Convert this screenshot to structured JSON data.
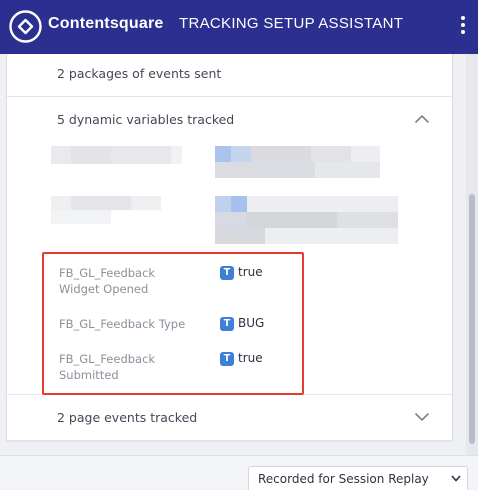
{
  "header": {
    "brand": "Contentsquare",
    "title": "TRACKING SETUP ASSISTANT",
    "logo_icon": "contentsquare-logo",
    "menu_icon": "kebab-menu-icon",
    "background": "#2b2f8f"
  },
  "summary": {
    "packages_label": "2 packages of events sent",
    "dynamic_vars_label": "5 dynamic variables tracked",
    "dynamic_vars_expanded": true,
    "page_events_label": "2 page events tracked",
    "page_events_expanded": false
  },
  "variables": [
    {
      "name": "FB_GL_Feedback Widget Opened",
      "type": "T",
      "value": "true"
    },
    {
      "name": "FB_GL_Feedback Type",
      "type": "T",
      "value": "BUG"
    },
    {
      "name": "FB_GL_Feedback Submitted",
      "type": "T",
      "value": "true"
    }
  ],
  "footer": {
    "select_value": "Recorded for Session Replay"
  },
  "colors": {
    "highlight": "#e53b2e",
    "type_badge": "#3e7fd8"
  }
}
